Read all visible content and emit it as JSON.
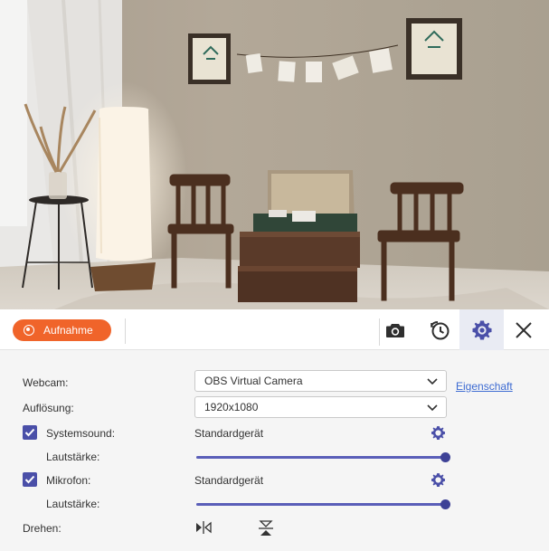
{
  "toolbar": {
    "record_label": "Aufnahme",
    "icons": [
      "camera-icon",
      "schedule-clock-icon",
      "settings-gear-icon",
      "close-icon"
    ],
    "accent_color": "#f0642a",
    "active_tab_color": "#4a4fa8"
  },
  "settings": {
    "webcam": {
      "label": "Webcam:",
      "value": "OBS Virtual Camera",
      "properties_link": "Eigenschaft"
    },
    "resolution": {
      "label": "Auflösung:",
      "value": "1920x1080"
    },
    "system_sound": {
      "label": "Systemsound:",
      "checked": true,
      "device": "Standardgerät",
      "volume_label": "Lautstärke:",
      "volume": 1.0
    },
    "microphone": {
      "label": "Mikrofon:",
      "checked": true,
      "device": "Standardgerät",
      "volume_label": "Lautstärke:",
      "volume": 1.0
    },
    "rotate": {
      "label": "Drehen:",
      "icons": [
        "flip-horizontal-icon",
        "flip-vertical-icon"
      ]
    }
  }
}
